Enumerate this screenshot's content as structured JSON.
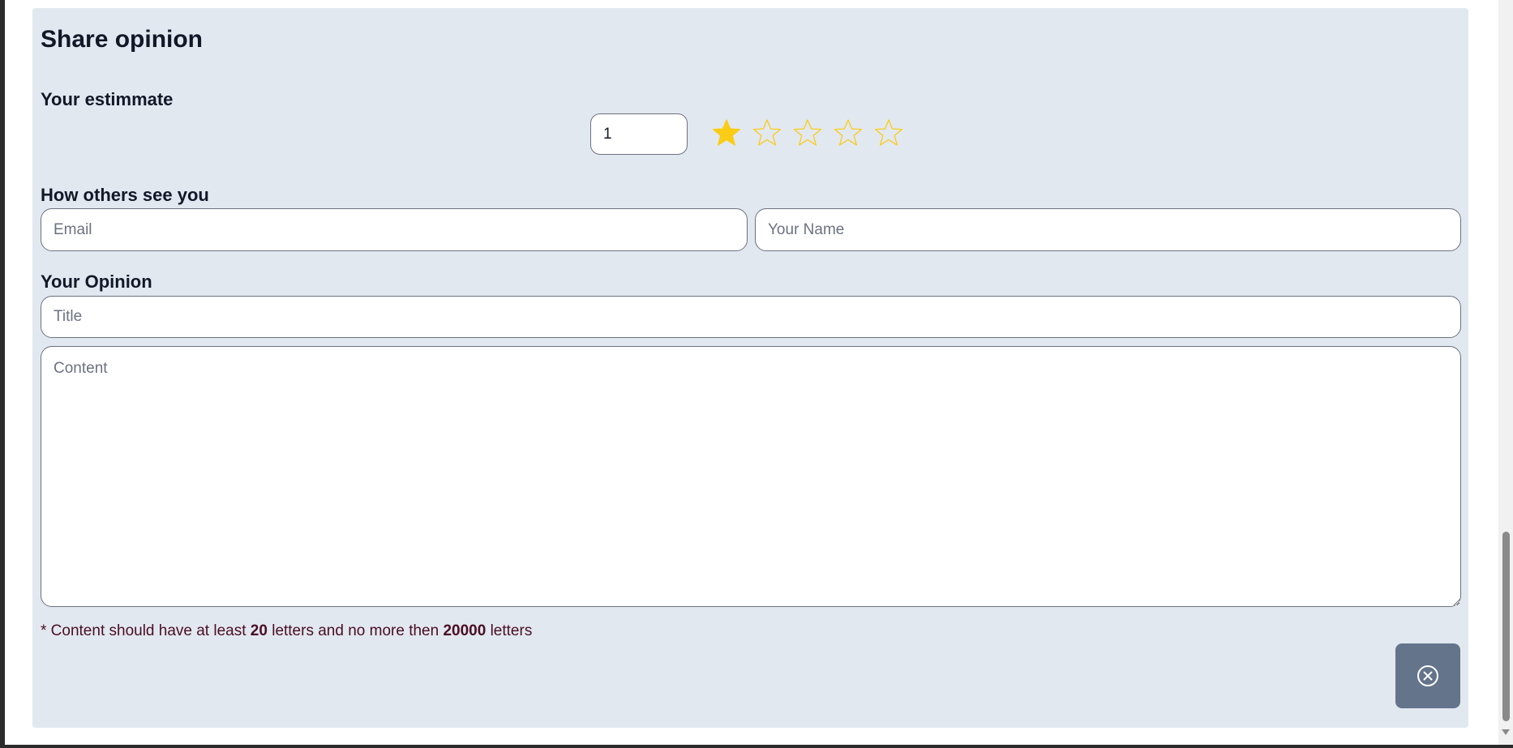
{
  "form": {
    "title": "Share opinion",
    "estimate_label": "Your estimmate",
    "rating_value": "1",
    "rating_max": 5,
    "rating_filled": 1,
    "identity_label": "How others see you",
    "email_placeholder": "Email",
    "name_placeholder": "Your Name",
    "opinion_label": "Your Opinion",
    "title_placeholder": "Title",
    "content_placeholder": "Content",
    "hint": {
      "prefix": "* Content should have at least ",
      "min": "20",
      "middle": " letters and no more then ",
      "max": "20000",
      "suffix": " letters"
    },
    "close_icon": "circle-x-icon"
  },
  "colors": {
    "panel_bg": "#e2e8f0",
    "star_fill": "#facc15",
    "star_outline": "#facc15",
    "close_button_bg": "#64748b",
    "hint_text": "#4a0e23"
  }
}
